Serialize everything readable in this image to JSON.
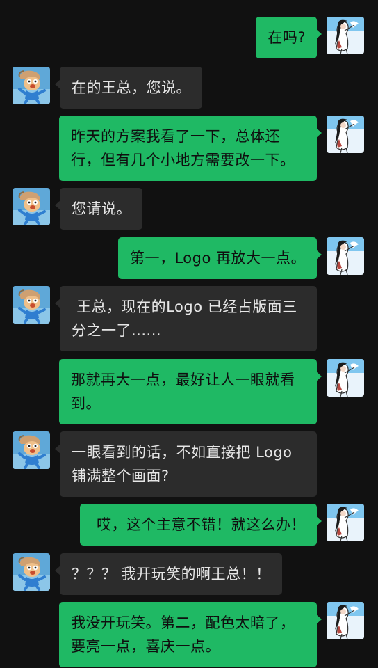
{
  "colors": {
    "background": "#111111",
    "incoming_bubble": "#2c2c2c",
    "outgoing_bubble": "#1fb964",
    "incoming_text": "#e6e6e6",
    "outgoing_text": "#0f0f0f"
  },
  "avatars": {
    "left": "cartoon-character-avatar",
    "right": "sketch-girl-avatar"
  },
  "messages": [
    {
      "side": "out",
      "text": "在吗?"
    },
    {
      "side": "in",
      "text": "在的王总，您说。"
    },
    {
      "side": "out",
      "text": "昨天的方案我看了一下，总体还行，但有几个小地方需要改一下。"
    },
    {
      "side": "in",
      "text": "您请说。"
    },
    {
      "side": "out",
      "text": "第一，Logo 再放大一点。"
    },
    {
      "side": "in",
      "text": " 王总，现在的Logo 已经占版面三分之一了......"
    },
    {
      "side": "out",
      "text": "那就再大一点，最好让人一眼就看到。"
    },
    {
      "side": "in",
      "text": "一眼看到的话，不如直接把 Logo 铺满整个画面?"
    },
    {
      "side": "out",
      "text": " 哎，这个主意不错！就这么办！"
    },
    {
      "side": "in",
      "text": "？？？ 我开玩笑的啊王总！！"
    },
    {
      "side": "out",
      "text": "我没开玩笑。第二，配色太暗了，要亮一点，喜庆一点。"
    }
  ]
}
